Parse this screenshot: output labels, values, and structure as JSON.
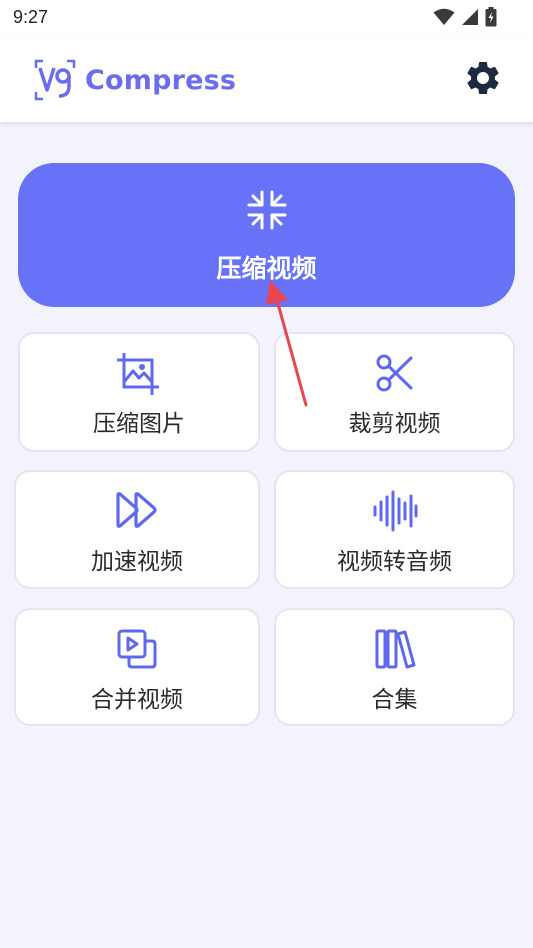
{
  "status_bar": {
    "time": "9:27"
  },
  "app_bar": {
    "logo_mark": "V9",
    "title": "Compress",
    "settings_icon": "gear-icon"
  },
  "main_action": {
    "label": "压缩视频",
    "icon": "compress-arrows-icon"
  },
  "tiles": [
    {
      "label": "压缩图片",
      "icon": "image-crop-icon"
    },
    {
      "label": "裁剪视频",
      "icon": "scissors-icon"
    },
    {
      "label": "加速视频",
      "icon": "fast-forward-icon"
    },
    {
      "label": "视频转音频",
      "icon": "audio-wave-icon"
    },
    {
      "label": "合并视频",
      "icon": "merge-video-icon"
    },
    {
      "label": "合集",
      "icon": "collection-icon"
    }
  ],
  "colors": {
    "primary": "#6772f8",
    "icon": "#5f68ee",
    "annotation": "#e8474f"
  }
}
